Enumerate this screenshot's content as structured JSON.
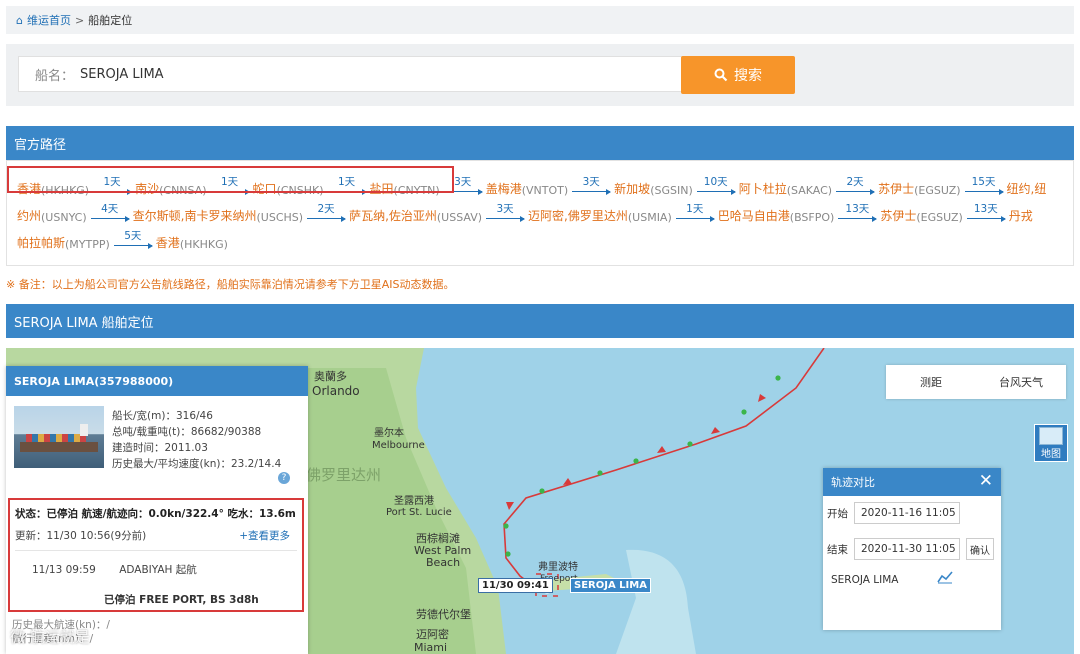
{
  "breadcrumb": {
    "home": "维运首页",
    "sep": ">",
    "current": "船舶定位"
  },
  "search": {
    "label": "船名：",
    "value": "SEROJA LIMA",
    "button": "搜索"
  },
  "route": {
    "title": "官方路径",
    "line1": [
      {
        "port": "香港",
        "code": "(HKHKG)",
        "days": "1天"
      },
      {
        "port": "南沙",
        "code": "(CNNSA)",
        "days": "1天"
      },
      {
        "port": "蛇口",
        "code": "(CNSHK)",
        "days": "1天"
      },
      {
        "port": "盐田",
        "code": "(CNYTN)",
        "days": "3天"
      },
      {
        "port": "盖梅港",
        "code": "(VNTOT)",
        "days": "3天"
      },
      {
        "port": "新加坡",
        "code": "(SGSIN)",
        "days": "10天"
      },
      {
        "port": "阿卜杜拉",
        "code": "(SAKAC)",
        "days": "2天"
      },
      {
        "port": "苏伊士",
        "code": "(EGSUZ)",
        "days": "15天"
      },
      {
        "port": "纽约,纽",
        "code": "",
        "days": ""
      }
    ],
    "line2": [
      {
        "port": "约州",
        "code": "(USNYC)",
        "days": "4天"
      },
      {
        "port": "查尔斯顿,南卡罗来纳州",
        "code": "(USCHS)",
        "days": "2天"
      },
      {
        "port": "萨瓦纳,佐治亚州",
        "code": "(USSAV)",
        "days": "3天"
      },
      {
        "port": "迈阿密,佛罗里达州",
        "code": "(USMIA)",
        "days": "1天"
      },
      {
        "port": "巴哈马自由港",
        "code": "(BSFPO)",
        "days": "13天"
      },
      {
        "port": "苏伊士",
        "code": "(EGSUZ)",
        "days": "13天"
      },
      {
        "port": "丹戎",
        "code": "",
        "days": ""
      }
    ],
    "line3": [
      {
        "port": "帕拉帕斯",
        "code": "(MYTPP)",
        "days": "5天"
      },
      {
        "port": "香港",
        "code": "(HKHKG)",
        "days": ""
      }
    ]
  },
  "note": "※ 备注：以上为船公司官方公告航线路径，船舶实际靠泊情况请参考下方卫星AIS动态数据。",
  "position": {
    "title": "SEROJA LIMA 船舶定位",
    "ship_header": "SEROJA LIMA(357988000)",
    "specs": [
      "船长/宽(m)：316/46",
      "总吨/载重吨(t)：86682/90388",
      "建造时间：2011.03",
      "历史最大/平均速度(kn)：23.2/14.4"
    ],
    "help": "?",
    "status": "状态：已停泊 航速/航迹向：0.0kn/322.4° 吃水：13.6m",
    "update": "更新：11/30 10:56(9分前)",
    "more": "+查看更多",
    "voyage_date": "11/13 09:59",
    "voyage_port": "ADABIYAH 起航",
    "berth": "已停泊 FREE PORT, BS 3d8h",
    "foot1": "历史最大航速(kn)：/",
    "foot2": "航行里程(nm)：/"
  },
  "map": {
    "tools": [
      "测距",
      "台风天气"
    ],
    "layer": "地图",
    "labels": [
      "奥蘭多",
      "Orlando",
      "墨尔本",
      "Melbourne",
      "佛罗里达州",
      "圣露西港",
      "Port St. Lucie",
      "西棕榈滩",
      "West Palm",
      "Beach",
      "弗里波特",
      "Freeport",
      "劳德代尔堡",
      "迈阿密",
      "Miami"
    ],
    "time_label": "11/30 09:41",
    "ship_label": "SEROJA LIMA",
    "watermark": "微 航运就是"
  },
  "track": {
    "title": "轨迹对比",
    "start_label": "开始",
    "start": "2020-11-16 11:05",
    "end_label": "结束",
    "end": "2020-11-30 11:05",
    "confirm": "确认",
    "ship": "SEROJA LIMA"
  },
  "colors": {
    "accent": "#3a87c8",
    "orange": "#f7952a",
    "port": "#e0701a",
    "link": "#1f6fb5",
    "highlight": "#d83a3a",
    "track": "#d83a3a"
  }
}
